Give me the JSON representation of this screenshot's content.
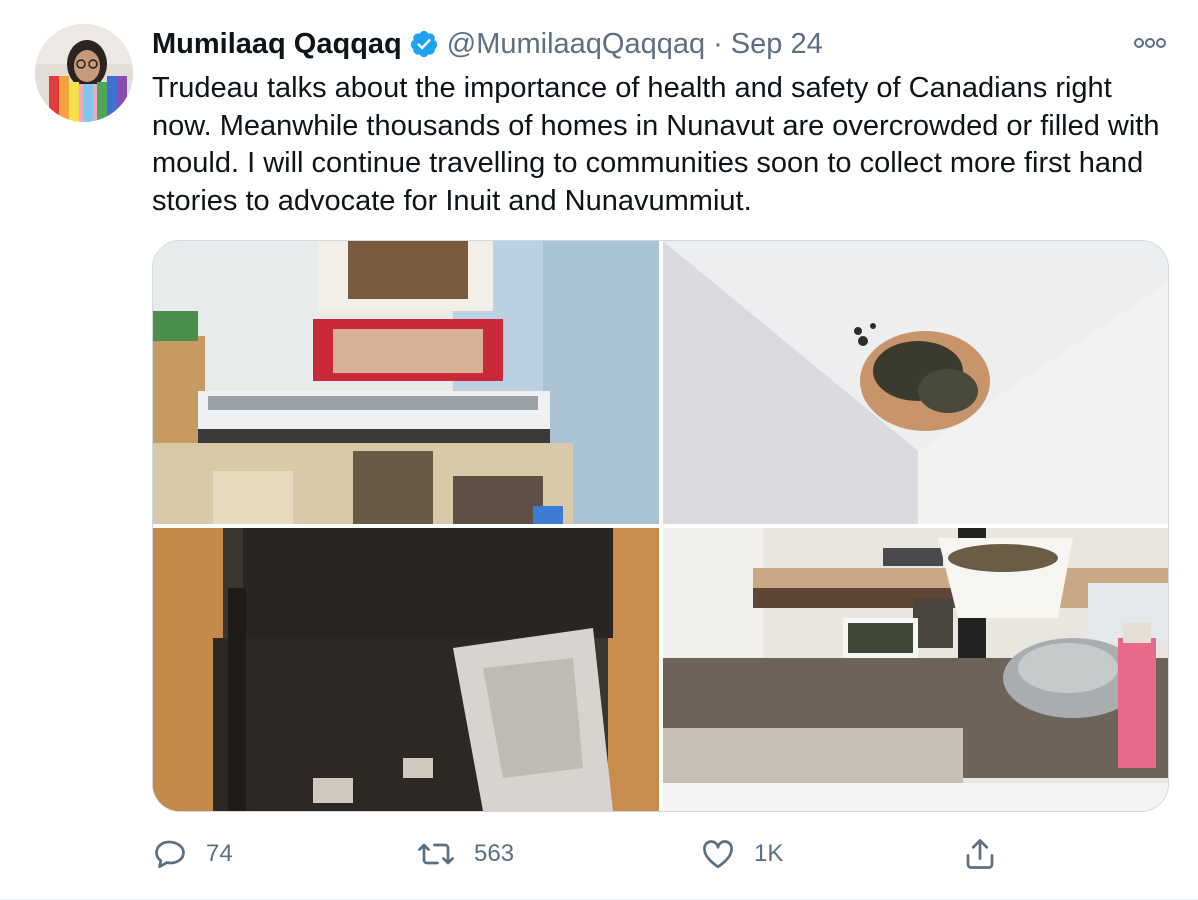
{
  "tweet": {
    "author": {
      "display_name": "Mumilaaq Qaqqaq",
      "handle": "@MumilaaqQaqqaq",
      "verified": true
    },
    "separator": "·",
    "date": "Sep 24",
    "more_icon": "more-horizontal-icon",
    "text": "Trudeau talks about the importance of health and safety of Canadians right now. Meanwhile thousands of homes in Nunavut are overcrowded or filled with mould. I will continue travelling to communities soon to collect more first hand stories to advocate for Inuit and Nunavummiut.",
    "media_count": 4
  },
  "actions": {
    "reply": {
      "icon": "reply-icon",
      "count": "74"
    },
    "retweet": {
      "icon": "retweet-icon",
      "count": "563"
    },
    "like": {
      "icon": "heart-icon",
      "count": "1K"
    },
    "share": {
      "icon": "share-icon"
    }
  },
  "colors": {
    "text_primary": "#0f1419",
    "text_secondary": "#5b7083",
    "verified_blue": "#1da1f2",
    "border": "#cfd9de"
  }
}
